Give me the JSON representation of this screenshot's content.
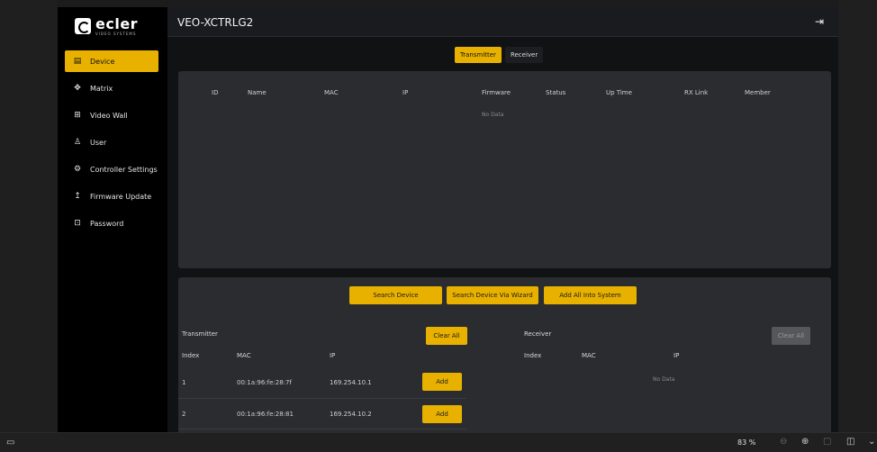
{
  "brand": {
    "name": "ecler",
    "sub": "VIDEO SYSTEMS"
  },
  "header": {
    "title": "VEO-XCTRLG2",
    "logout_icon": "logout-icon"
  },
  "sidebar": {
    "items": [
      {
        "label": "Device",
        "icon": "▤"
      },
      {
        "label": "Matrix",
        "icon": "✥"
      },
      {
        "label": "Video Wall",
        "icon": "⊞"
      },
      {
        "label": "User",
        "icon": "♙"
      },
      {
        "label": "Controller Settings",
        "icon": "⚙"
      },
      {
        "label": "Firmware Update",
        "icon": "↥"
      },
      {
        "label": "Password",
        "icon": "⊡"
      }
    ]
  },
  "tabs": {
    "transmitter": "Transmitter",
    "receiver": "Receiver"
  },
  "device_table": {
    "columns": [
      "ID",
      "Name",
      "MAC",
      "IP",
      "Firmware",
      "Status",
      "Up Time",
      "RX Link",
      "Member"
    ],
    "empty": "No Data"
  },
  "search": {
    "search_device": "Search Device",
    "search_wizard": "Search Device Via Wizard",
    "add_all": "Add All Into System"
  },
  "transmitter_list": {
    "title": "Transmitter",
    "clear_all": "Clear All",
    "columns": [
      "Index",
      "MAC",
      "IP"
    ],
    "rows": [
      {
        "index": "1",
        "mac": "00:1a:96:fe:28:7f",
        "ip": "169.254.10.1",
        "action": "Add"
      },
      {
        "index": "2",
        "mac": "00:1a:96:fe:28:81",
        "ip": "169.254.10.2",
        "action": "Add"
      }
    ]
  },
  "receiver_list": {
    "title": "Receiver",
    "clear_all": "Clear All",
    "columns": [
      "Index",
      "MAC",
      "IP"
    ],
    "empty": "No Data"
  },
  "statusbar": {
    "zoom": "83 %"
  },
  "colors": {
    "accent": "#e8b100",
    "panel": "#2a2c30",
    "sidebar": "#000000"
  }
}
